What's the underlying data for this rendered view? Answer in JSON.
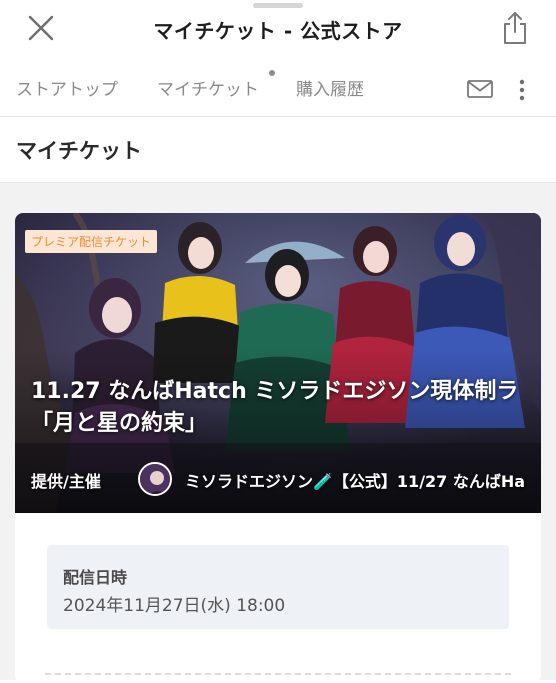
{
  "header": {
    "title": "マイチケット - 公式ストア",
    "close_icon": "close-icon",
    "share_icon": "share-icon"
  },
  "tabs": [
    {
      "label": "ストアトップ"
    },
    {
      "label": "マイチケット",
      "has_dot": true
    },
    {
      "label": "購入履歴"
    }
  ],
  "section": {
    "title": "マイチケット"
  },
  "ticket": {
    "badge": "プレミア配信チケット",
    "title_line1": "11.27 なんばHatch ミソラドエジソン現体制ラ",
    "title_line2": "「月と星の約束」",
    "host_label": "提供/主催",
    "host_name": "ミソラドエジソン🧪【公式】11/27 なんばHa",
    "date_label": "配信日時",
    "date_value": "2024年11月27日(水) 18:00"
  },
  "colors": {
    "badge_bg": "#fde7d4",
    "badge_text": "#e78b3a",
    "date_box_bg": "#eef1f5",
    "page_gray": "#f2f2f2"
  }
}
